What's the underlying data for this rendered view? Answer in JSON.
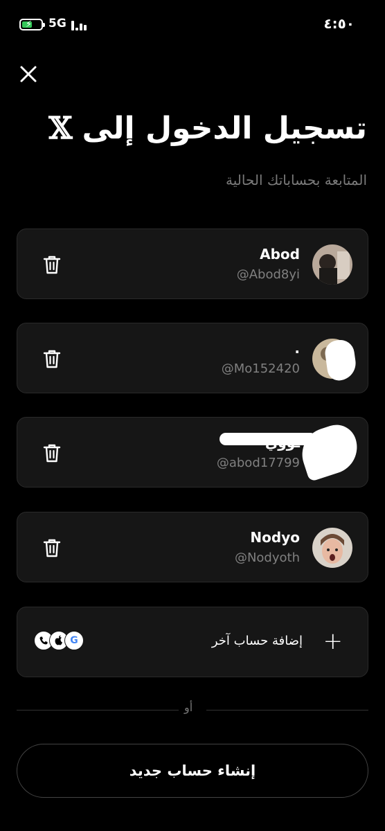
{
  "status_bar": {
    "network": "5G",
    "time": "٤:٥٠",
    "battery_level": 0.55,
    "battery_color": "#34c759"
  },
  "header": {
    "title": "تسجيل الدخول إلى",
    "logo": "𝕏",
    "subtitle": "المتابعة بحساباتك الحالية"
  },
  "accounts": [
    {
      "name": "Abod",
      "handle": "@Abod8yi"
    },
    {
      "name": ".",
      "handle": "@Mo152420"
    },
    {
      "name": "ـووي",
      "handle": "@abod17799"
    },
    {
      "name": "Nodyo",
      "handle": "@Nodyoth"
    }
  ],
  "add_account": {
    "label": "إضافة حساب آخر",
    "icon": "plus-icon",
    "providers": [
      "phone-icon",
      "apple-icon",
      "G"
    ]
  },
  "separator": {
    "label": "أو"
  },
  "create_account": {
    "label": "إنشاء حساب جديد"
  },
  "colors": {
    "background": "#000000",
    "card": "#161616",
    "muted_text": "#808080"
  }
}
